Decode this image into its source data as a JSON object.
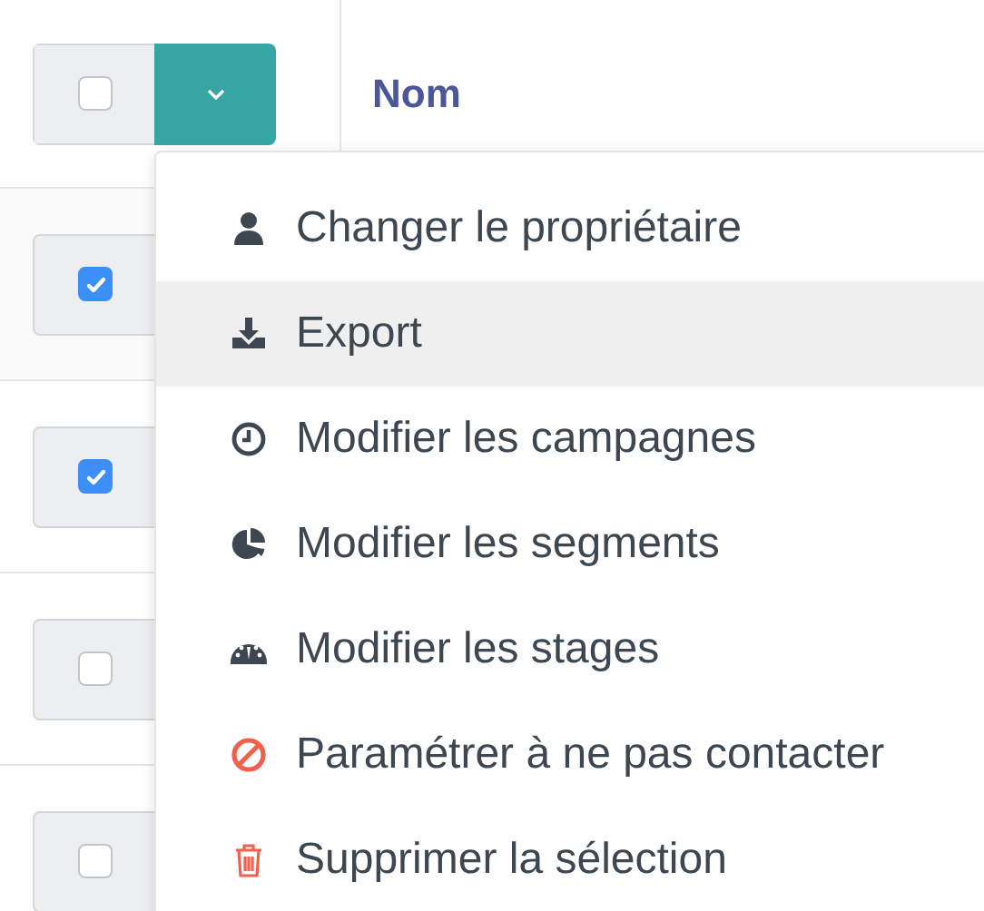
{
  "header": {
    "select_all": {
      "checked": false
    },
    "column": "Nom"
  },
  "rows": [
    {
      "checked": true
    },
    {
      "checked": true
    },
    {
      "checked": false
    },
    {
      "checked": false
    }
  ],
  "menu": [
    {
      "kind": "user",
      "label": "Changer le propriétaire",
      "selected": false,
      "color": "#3d4752"
    },
    {
      "kind": "download",
      "label": "Export",
      "selected": true,
      "color": "#3d4752"
    },
    {
      "kind": "clock",
      "label": "Modifier les campagnes",
      "selected": false,
      "color": "#3d4752"
    },
    {
      "kind": "pie",
      "label": "Modifier les segments",
      "selected": false,
      "color": "#3d4752"
    },
    {
      "kind": "gauge",
      "label": "Modifier les stages",
      "selected": false,
      "color": "#3d4752"
    },
    {
      "kind": "ban",
      "label": "Paramétrer à ne pas contacter",
      "selected": false,
      "color": "#f0604d"
    },
    {
      "kind": "trash",
      "label": "Supprimer la sélection",
      "selected": false,
      "color": "#f0604d"
    }
  ]
}
